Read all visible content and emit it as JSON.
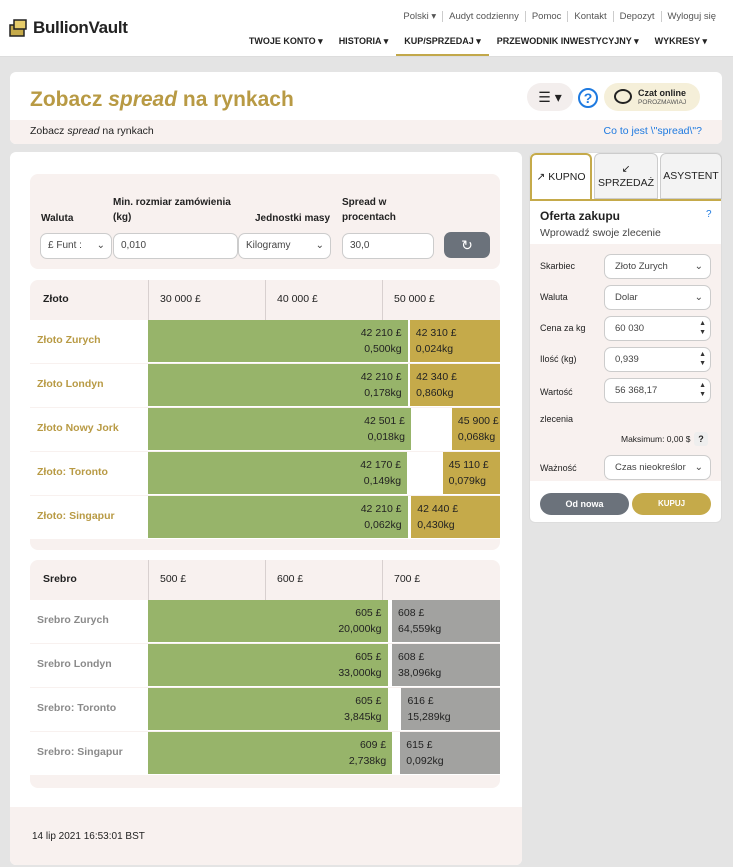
{
  "brand": {
    "name": "BullionVault"
  },
  "utility_nav": [
    "Polski ▾",
    "Audyt codzienny",
    "Pomoc",
    "Kontakt",
    "Depozyt",
    "Wyloguj się"
  ],
  "main_nav": [
    {
      "label": "TWOJE KONTO ▾",
      "active": false
    },
    {
      "label": "HISTORIA ▾",
      "active": false
    },
    {
      "label": "KUP/SPRZEDAJ ▾",
      "active": true
    },
    {
      "label": "PRZEWODNIK INWESTYCYJNY ▾",
      "active": false
    },
    {
      "label": "WYKRESY ▾",
      "active": false
    }
  ],
  "header": {
    "title_pre": "Zobacz ",
    "title_em": "spread",
    "title_post": " na rynkach",
    "menu_icon": "☰ ▾",
    "help_icon": "?",
    "chat_title": "Czat online",
    "chat_sub": "POROZMAWIAJ",
    "crumb_pre": "Zobacz ",
    "crumb_em": "spread",
    "crumb_post": " na rynkach",
    "spread_link": "Co to jest \\\"spread\\\"?"
  },
  "filters": {
    "currency_label": "Waluta",
    "currency_value": "£ Funt :",
    "min_size_label": "Min. rozmiar zamówienia (kg)",
    "min_size_value": "0,010",
    "units_label": "Jednostki masy",
    "units_value": "Kilogramy",
    "spread_label": "Spread w procentach",
    "spread_value": "30,0"
  },
  "gold": {
    "title": "Złoto",
    "ticks": [
      "30 000 £",
      "40 000 £",
      "50 000 £"
    ],
    "rows": [
      {
        "name": "Złoto Zurych",
        "bid_price": "42 210 £",
        "bid_qty": "0,500kg",
        "ask_price": "42 310 £",
        "ask_qty": "0,024kg"
      },
      {
        "name": "Złoto Londyn",
        "bid_price": "42 210 £",
        "bid_qty": "0,178kg",
        "ask_price": "42 340 £",
        "ask_qty": "0,860kg"
      },
      {
        "name": "Złoto Nowy Jork",
        "bid_price": "42 501 £",
        "bid_qty": "0,018kg",
        "ask_price": "45 900 £",
        "ask_qty": "0,068kg"
      },
      {
        "name": "Złoto: Toronto",
        "bid_price": "42 170 £",
        "bid_qty": "0,149kg",
        "ask_price": "45 110 £",
        "ask_qty": "0,079kg"
      },
      {
        "name": "Złoto: Singapur",
        "bid_price": "42 210 £",
        "bid_qty": "0,062kg",
        "ask_price": "42 440 £",
        "ask_qty": "0,430kg"
      }
    ]
  },
  "silver": {
    "title": "Srebro",
    "ticks": [
      "500 £",
      "600 £",
      "700 £"
    ],
    "rows": [
      {
        "name": "Srebro Zurych",
        "bid_price": "605 £",
        "bid_qty": "20,000kg",
        "ask_price": "608 £",
        "ask_qty": "64,559kg"
      },
      {
        "name": "Srebro Londyn",
        "bid_price": "605 £",
        "bid_qty": "33,000kg",
        "ask_price": "608 £",
        "ask_qty": "38,096kg"
      },
      {
        "name": "Srebro: Toronto",
        "bid_price": "605 £",
        "bid_qty": "3,845kg",
        "ask_price": "616 £",
        "ask_qty": "15,289kg"
      },
      {
        "name": "Srebro: Singapur",
        "bid_price": "609 £",
        "bid_qty": "2,738kg",
        "ask_price": "615 £",
        "ask_qty": "0,092kg"
      }
    ]
  },
  "timestamp": "14 lip 2021 16:53:01 BST",
  "order_panel": {
    "tab_buy": "KUPNO",
    "tab_sell": "SPRZEDAŻ",
    "tab_assist": "ASYSTENT",
    "title": "Oferta zakupu",
    "subtitle": "Wprowadź swoje zlecenie",
    "help": "?",
    "vault_label": "Skarbiec",
    "vault_value": "Złoto Zurych",
    "currency_label": "Waluta",
    "currency_value": "Dolar",
    "price_label": "Cena za kg",
    "price_value": "60 030",
    "qty_label": "Ilość (kg)",
    "qty_value": "0,939",
    "value_label": "Wartość",
    "value_label2": "zlecenia",
    "value_value": "56 368,17",
    "max_text": "Maksimum: 0,00 $",
    "validity_label": "Ważność",
    "validity_value": "Czas nieokreślor",
    "reset_label": "Od nowa",
    "buy_label": "KUPUJ"
  },
  "colors": {
    "gold": "#c5aa4a",
    "bid_green": "#97b46a",
    "silver_ask": "#a2a2a0",
    "link": "#1e7ae0",
    "gold_text": "#b89a44"
  }
}
